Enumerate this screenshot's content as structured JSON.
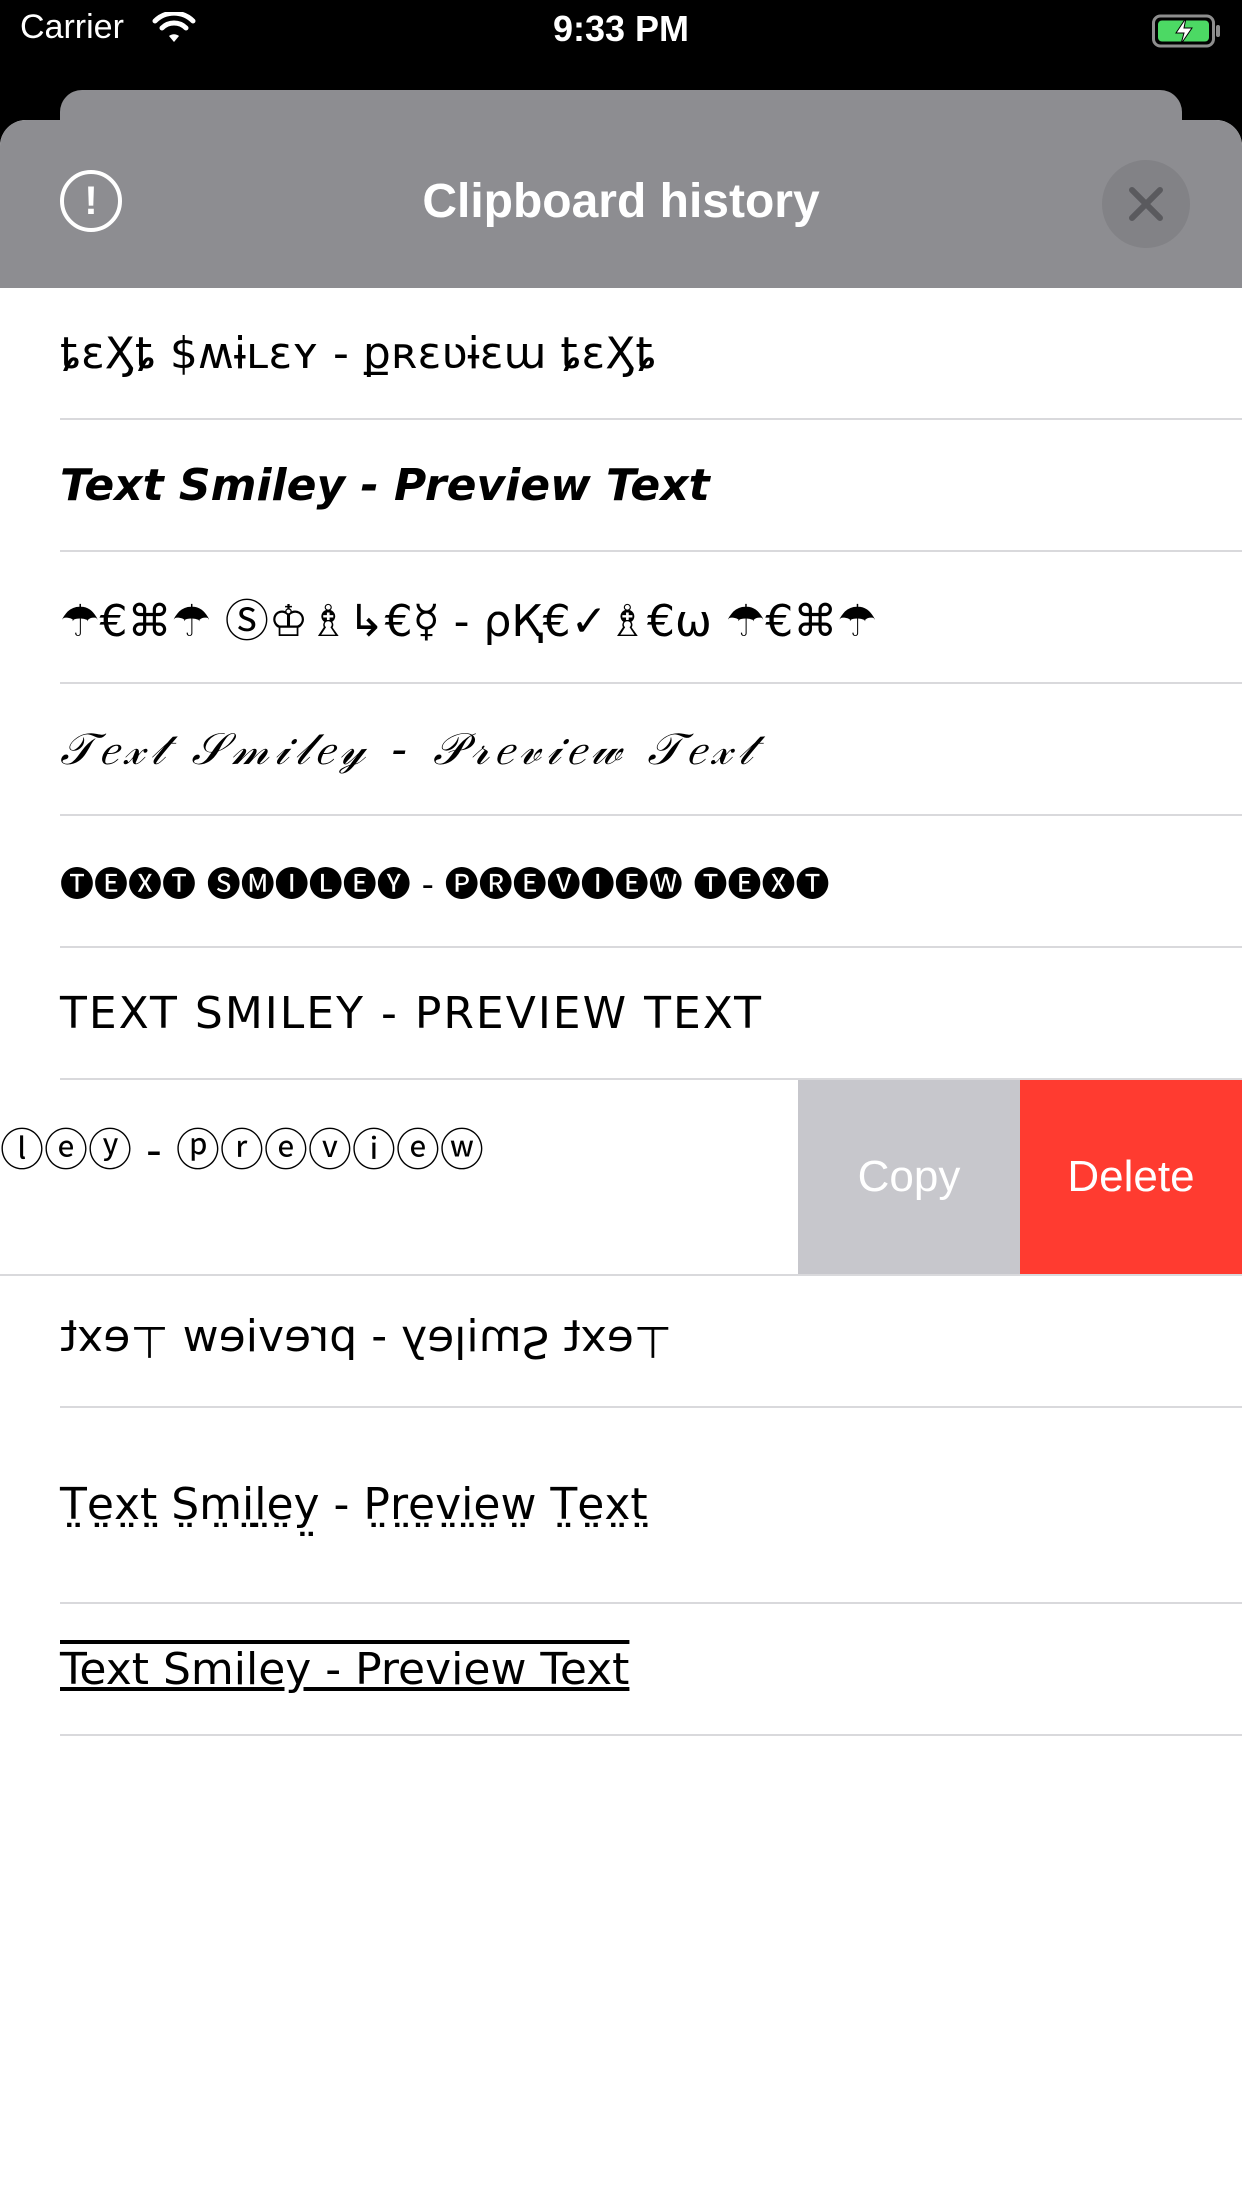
{
  "status_bar": {
    "carrier": "Carrier",
    "time": "9:33 PM"
  },
  "header": {
    "title": "Clipboard history",
    "info_icon": "exclamation-circle-icon",
    "close_icon": "close-icon"
  },
  "items": [
    {
      "text": "ȶɛӼȶ $ʍɨʟɛʏ - քʀɛʋɨɛա ȶɛӼȶ"
    },
    {
      "text": "Text Smiley - Preview Text"
    },
    {
      "text": "☂€⌘☂ Ⓢ♔♗↳€☿ - ρҚ€✓♗€ω ☂€⌘☂"
    },
    {
      "text": "𝒯𝑒𝓍𝓉 𝒮𝓂𝒾𝓁𝑒𝓎 - 𝒫𝓇𝑒𝓋𝒾𝑒𝓌 𝒯𝑒𝓍𝓉"
    },
    {
      "text": "🅣🅔🅧🅣 🅢🅜🅘🅛🅔🅨 - 🅟🅡🅔🅥🅘🅔🅦 🅣🅔🅧🅣"
    },
    {
      "text": "TEXT SMILEY - PREVIEW TEXT"
    }
  ],
  "swiped_item": {
    "text": "ⓛⓔⓨ - ⓟⓡⓔⓥⓘⓔⓦ",
    "copy_label": "Copy",
    "delete_label": "Delete"
  },
  "items_after": [
    {
      "text": "ʇxǝ⊥ ʍǝᴉʌǝɹd - ʎǝlᴉɯS ʇxǝ⊥"
    },
    {
      "text": "T̤e̤x̤t̤ S̤m̤i̤l̤e̤y̤ - P̤r̤e̤v̤i̤e̤w̤ T̤e̤x̤t̤"
    },
    {
      "text": "Text Smiley - Preview Text"
    }
  ]
}
